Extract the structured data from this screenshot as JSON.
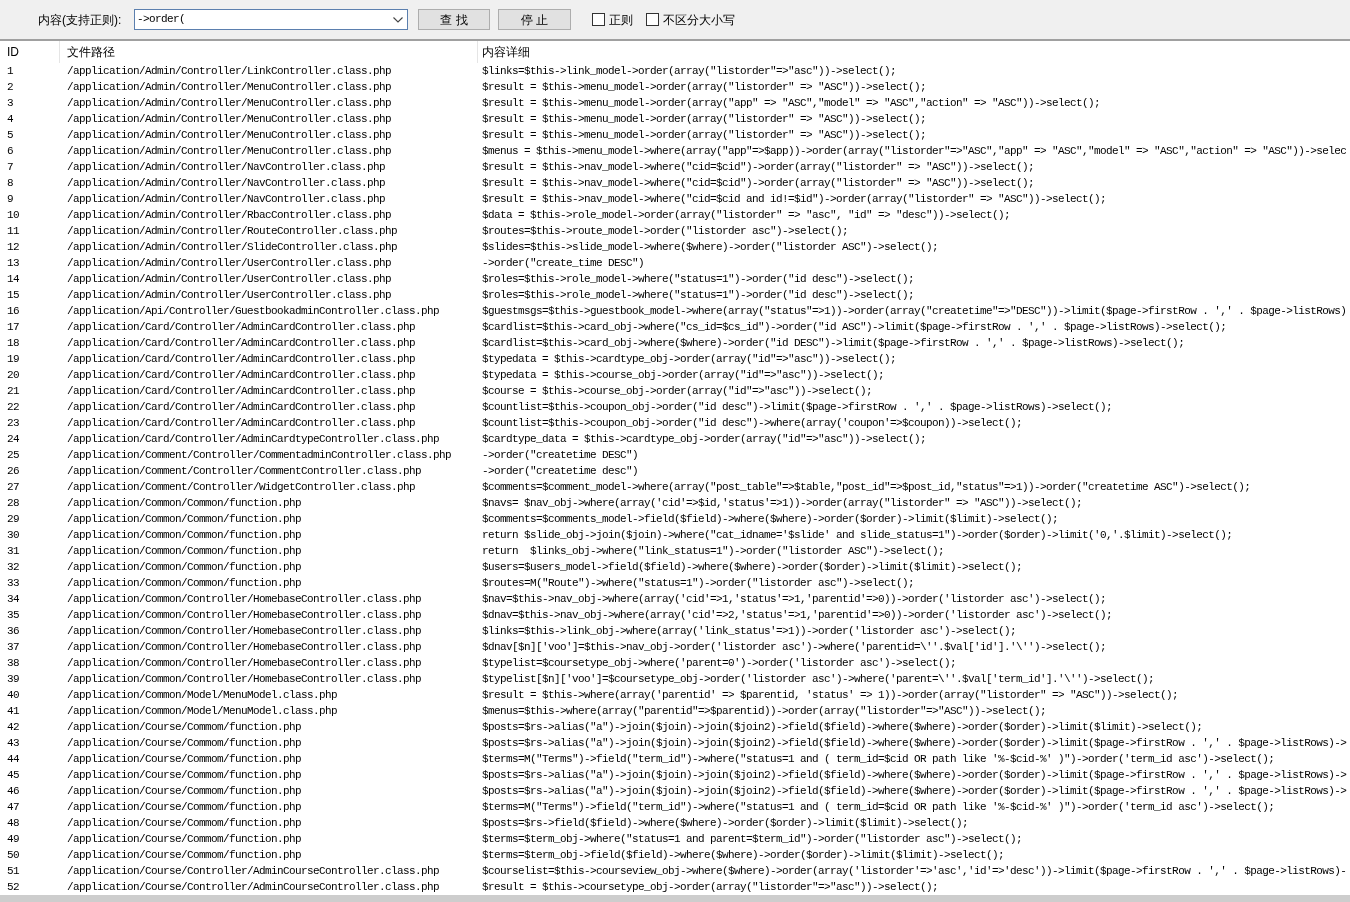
{
  "search_bar": {
    "label": "内容(支持正则):",
    "query": "->order(",
    "buttons": [
      "查 找",
      "停 止"
    ],
    "options": [
      {
        "label": "正则",
        "checked": false
      },
      {
        "label": "不区分大小写",
        "checked": false
      }
    ]
  },
  "table": {
    "columns": [
      "ID",
      "文件路径",
      "内容详细"
    ],
    "rows": [
      {
        "id": "1",
        "path": "/application/Admin/Controller/LinkController.class.php",
        "content": "$links=$this->link_model->order(array(\"listorder\"=>\"asc\"))->select();"
      },
      {
        "id": "2",
        "path": "/application/Admin/Controller/MenuController.class.php",
        "content": "$result = $this->menu_model->order(array(\"listorder\" => \"ASC\"))->select();"
      },
      {
        "id": "3",
        "path": "/application/Admin/Controller/MenuController.class.php",
        "content": "$result = $this->menu_model->order(array(\"app\" => \"ASC\",\"model\" => \"ASC\",\"action\" => \"ASC\"))->select();"
      },
      {
        "id": "4",
        "path": "/application/Admin/Controller/MenuController.class.php",
        "content": "$result = $this->menu_model->order(array(\"listorder\" => \"ASC\"))->select();"
      },
      {
        "id": "5",
        "path": "/application/Admin/Controller/MenuController.class.php",
        "content": "$result = $this->menu_model->order(array(\"listorder\" => \"ASC\"))->select();"
      },
      {
        "id": "6",
        "path": "/application/Admin/Controller/MenuController.class.php",
        "content": "$menus = $this->menu_model->where(array(\"app\"=>$app))->order(array(\"listorder\"=>\"ASC\",\"app\" => \"ASC\",\"model\" => \"ASC\",\"action\" => \"ASC\"))->selec"
      },
      {
        "id": "7",
        "path": "/application/Admin/Controller/NavController.class.php",
        "content": "$result = $this->nav_model->where(\"cid=$cid\")->order(array(\"listorder\" => \"ASC\"))->select();"
      },
      {
        "id": "8",
        "path": "/application/Admin/Controller/NavController.class.php",
        "content": "$result = $this->nav_model->where(\"cid=$cid\")->order(array(\"listorder\" => \"ASC\"))->select();"
      },
      {
        "id": "9",
        "path": "/application/Admin/Controller/NavController.class.php",
        "content": "$result = $this->nav_model->where(\"cid=$cid and id!=$id\")->order(array(\"listorder\" => \"ASC\"))->select();"
      },
      {
        "id": "10",
        "path": "/application/Admin/Controller/RbacController.class.php",
        "content": "$data = $this->role_model->order(array(\"listorder\" => \"asc\", \"id\" => \"desc\"))->select();"
      },
      {
        "id": "11",
        "path": "/application/Admin/Controller/RouteController.class.php",
        "content": "$routes=$this->route_model->order(\"listorder asc\")->select();"
      },
      {
        "id": "12",
        "path": "/application/Admin/Controller/SlideController.class.php",
        "content": "$slides=$this->slide_model->where($where)->order(\"listorder ASC\")->select();"
      },
      {
        "id": "13",
        "path": "/application/Admin/Controller/UserController.class.php",
        "content": "->order(\"create_time DESC\")"
      },
      {
        "id": "14",
        "path": "/application/Admin/Controller/UserController.class.php",
        "content": "$roles=$this->role_model->where(\"status=1\")->order(\"id desc\")->select();"
      },
      {
        "id": "15",
        "path": "/application/Admin/Controller/UserController.class.php",
        "content": "$roles=$this->role_model->where(\"status=1\")->order(\"id desc\")->select();"
      },
      {
        "id": "16",
        "path": "/application/Api/Controller/GuestbookadminController.class.php",
        "content": "$guestmsgs=$this->guestbook_model->where(array(\"status\"=>1))->order(array(\"createtime\"=>\"DESC\"))->limit($page->firstRow . ',' . $page->listRows)"
      },
      {
        "id": "17",
        "path": "/application/Card/Controller/AdminCardController.class.php",
        "content": "$cardlist=$this->card_obj->where(\"cs_id=$cs_id\")->order(\"id ASC\")->limit($page->firstRow . ',' . $page->listRows)->select();"
      },
      {
        "id": "18",
        "path": "/application/Card/Controller/AdminCardController.class.php",
        "content": "$cardlist=$this->card_obj->where($where)->order(\"id DESC\")->limit($page->firstRow . ',' . $page->listRows)->select();"
      },
      {
        "id": "19",
        "path": "/application/Card/Controller/AdminCardController.class.php",
        "content": "$typedata = $this->cardtype_obj->order(array(\"id\"=>\"asc\"))->select();"
      },
      {
        "id": "20",
        "path": "/application/Card/Controller/AdminCardController.class.php",
        "content": "$typedata = $this->course_obj->order(array(\"id\"=>\"asc\"))->select();"
      },
      {
        "id": "21",
        "path": "/application/Card/Controller/AdminCardController.class.php",
        "content": "$course = $this->course_obj->order(array(\"id\"=>\"asc\"))->select();"
      },
      {
        "id": "22",
        "path": "/application/Card/Controller/AdminCardController.class.php",
        "content": "$countlist=$this->coupon_obj->order(\"id desc\")->limit($page->firstRow . ',' . $page->listRows)->select();"
      },
      {
        "id": "23",
        "path": "/application/Card/Controller/AdminCardController.class.php",
        "content": "$countlist=$this->coupon_obj->order(\"id desc\")->where(array('coupon'=>$coupon))->select();"
      },
      {
        "id": "24",
        "path": "/application/Card/Controller/AdminCardtypeController.class.php",
        "content": "$cardtype_data = $this->cardtype_obj->order(array(\"id\"=>\"asc\"))->select();"
      },
      {
        "id": "25",
        "path": "/application/Comment/Controller/CommentadminController.class.php",
        "content": "->order(\"createtime DESC\")"
      },
      {
        "id": "26",
        "path": "/application/Comment/Controller/CommentController.class.php",
        "content": "->order(\"createtime desc\")"
      },
      {
        "id": "27",
        "path": "/application/Comment/Controller/WidgetController.class.php",
        "content": "$comments=$comment_model->where(array(\"post_table\"=>$table,\"post_id\"=>$post_id,\"status\"=>1))->order(\"createtime ASC\")->select();"
      },
      {
        "id": "28",
        "path": "/application/Common/Common/function.php",
        "content": "$navs= $nav_obj->where(array('cid'=>$id,'status'=>1))->order(array(\"listorder\" => \"ASC\"))->select();"
      },
      {
        "id": "29",
        "path": "/application/Common/Common/function.php",
        "content": "$comments=$comments_model->field($field)->where($where)->order($order)->limit($limit)->select();"
      },
      {
        "id": "30",
        "path": "/application/Common/Common/function.php",
        "content": "return $slide_obj->join($join)->where(\"cat_idname='$slide' and slide_status=1\")->order($order)->limit('0,'.$limit)->select();"
      },
      {
        "id": "31",
        "path": "/application/Common/Common/function.php",
        "content": "return  $links_obj->where(\"link_status=1\")->order(\"listorder ASC\")->select();"
      },
      {
        "id": "32",
        "path": "/application/Common/Common/function.php",
        "content": "$users=$users_model->field($field)->where($where)->order($order)->limit($limit)->select();"
      },
      {
        "id": "33",
        "path": "/application/Common/Common/function.php",
        "content": "$routes=M(\"Route\")->where(\"status=1\")->order(\"listorder asc\")->select();"
      },
      {
        "id": "34",
        "path": "/application/Common/Controller/HomebaseController.class.php",
        "content": "$nav=$this->nav_obj->where(array('cid'=>1,'status'=>1,'parentid'=>0))->order('listorder asc')->select();"
      },
      {
        "id": "35",
        "path": "/application/Common/Controller/HomebaseController.class.php",
        "content": "$dnav=$this->nav_obj->where(array('cid'=>2,'status'=>1,'parentid'=>0))->order('listorder asc')->select();"
      },
      {
        "id": "36",
        "path": "/application/Common/Controller/HomebaseController.class.php",
        "content": "$links=$this->link_obj->where(array('link_status'=>1))->order('listorder asc')->select();"
      },
      {
        "id": "37",
        "path": "/application/Common/Controller/HomebaseController.class.php",
        "content": "$dnav[$n]['voo']=$this->nav_obj->order('listorder asc')->where('parentid=\\''.$val['id'].'\\'')->select();"
      },
      {
        "id": "38",
        "path": "/application/Common/Controller/HomebaseController.class.php",
        "content": "$typelist=$coursetype_obj->where('parent=0')->order('listorder asc')->select();"
      },
      {
        "id": "39",
        "path": "/application/Common/Controller/HomebaseController.class.php",
        "content": "$typelist[$n]['voo']=$coursetype_obj->order('listorder asc')->where('parent=\\''.$val['term_id'].'\\'')->select();"
      },
      {
        "id": "40",
        "path": "/application/Common/Model/MenuModel.class.php",
        "content": "$result = $this->where(array('parentid' => $parentid, 'status' => 1))->order(array(\"listorder\" => \"ASC\"))->select();"
      },
      {
        "id": "41",
        "path": "/application/Common/Model/MenuModel.class.php",
        "content": "$menus=$this->where(array(\"parentid\"=>$parentid))->order(array(\"listorder\"=>\"ASC\"))->select();"
      },
      {
        "id": "42",
        "path": "/application/Course/Commom/function.php",
        "content": "$posts=$rs->alias(\"a\")->join($join)->join($join2)->field($field)->where($where)->order($order)->limit($limit)->select();"
      },
      {
        "id": "43",
        "path": "/application/Course/Commom/function.php",
        "content": "$posts=$rs->alias(\"a\")->join($join)->join($join2)->field($field)->where($where)->order($order)->limit($page->firstRow . ',' . $page->listRows)->"
      },
      {
        "id": "44",
        "path": "/application/Course/Commom/function.php",
        "content": "$terms=M(\"Terms\")->field(\"term_id\")->where(\"status=1 and ( term_id=$cid OR path like '%-$cid-%' )\")->order('term_id asc')->select();"
      },
      {
        "id": "45",
        "path": "/application/Course/Commom/function.php",
        "content": "$posts=$rs->alias(\"a\")->join($join)->join($join2)->field($field)->where($where)->order($order)->limit($page->firstRow . ',' . $page->listRows)->"
      },
      {
        "id": "46",
        "path": "/application/Course/Commom/function.php",
        "content": "$posts=$rs->alias(\"a\")->join($join)->join($join2)->field($field)->where($where)->order($order)->limit($page->firstRow . ',' . $page->listRows)->"
      },
      {
        "id": "47",
        "path": "/application/Course/Commom/function.php",
        "content": "$terms=M(\"Terms\")->field(\"term_id\")->where(\"status=1 and ( term_id=$cid OR path like '%-$cid-%' )\")->order('term_id asc')->select();"
      },
      {
        "id": "48",
        "path": "/application/Course/Commom/function.php",
        "content": "$posts=$rs->field($field)->where($where)->order($order)->limit($limit)->select();"
      },
      {
        "id": "49",
        "path": "/application/Course/Commom/function.php",
        "content": "$terms=$term_obj->where(\"status=1 and parent=$term_id\")->order(\"listorder asc\")->select();"
      },
      {
        "id": "50",
        "path": "/application/Course/Commom/function.php",
        "content": "$terms=$term_obj->field($field)->where($where)->order($order)->limit($limit)->select();"
      },
      {
        "id": "51",
        "path": "/application/Course/Controller/AdminCourseController.class.php",
        "content": "$courselist=$this->courseview_obj->where($where)->order(array('listorder'=>'asc','id'=>'desc'))->limit($page->firstRow . ',' . $page->listRows)-"
      },
      {
        "id": "52",
        "path": "/application/Course/Controller/AdminCourseController.class.php",
        "content": "$result = $this->coursetype_obj->order(array(\"listorder\"=>\"asc\"))->select();"
      }
    ]
  }
}
